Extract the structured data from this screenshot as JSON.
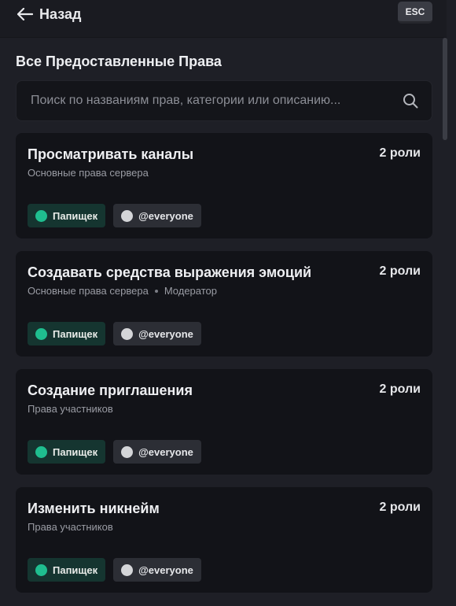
{
  "header": {
    "back_label": "Назад",
    "esc_label": "ESC"
  },
  "section": {
    "title": "Все Предоставленные Права"
  },
  "search": {
    "placeholder": "Поиск по названиям прав, категории или описанию..."
  },
  "permissions": [
    {
      "title": "Просматривать каналы",
      "count": "2 роли",
      "category": "Основные права сервера",
      "extra": "",
      "roles": [
        {
          "name": "Папищек",
          "color": "#1fbe8f"
        },
        {
          "name": "@everyone",
          "color": "#d4d5d8"
        }
      ]
    },
    {
      "title": "Создавать средства выражения эмоций",
      "count": "2 роли",
      "category": "Основные права сервера",
      "extra": "Модератор",
      "roles": [
        {
          "name": "Папищек",
          "color": "#1fbe8f"
        },
        {
          "name": "@everyone",
          "color": "#d4d5d8"
        }
      ]
    },
    {
      "title": "Создание приглашения",
      "count": "2 роли",
      "category": "Права участников",
      "extra": "",
      "roles": [
        {
          "name": "Папищек",
          "color": "#1fbe8f"
        },
        {
          "name": "@everyone",
          "color": "#d4d5d8"
        }
      ]
    },
    {
      "title": "Изменить никнейм",
      "count": "2 роли",
      "category": "Права участников",
      "extra": "",
      "roles": [
        {
          "name": "Папищек",
          "color": "#1fbe8f"
        },
        {
          "name": "@everyone",
          "color": "#d4d5d8"
        }
      ]
    }
  ],
  "icons": {
    "back": "arrow-left-icon",
    "search": "search-icon"
  }
}
